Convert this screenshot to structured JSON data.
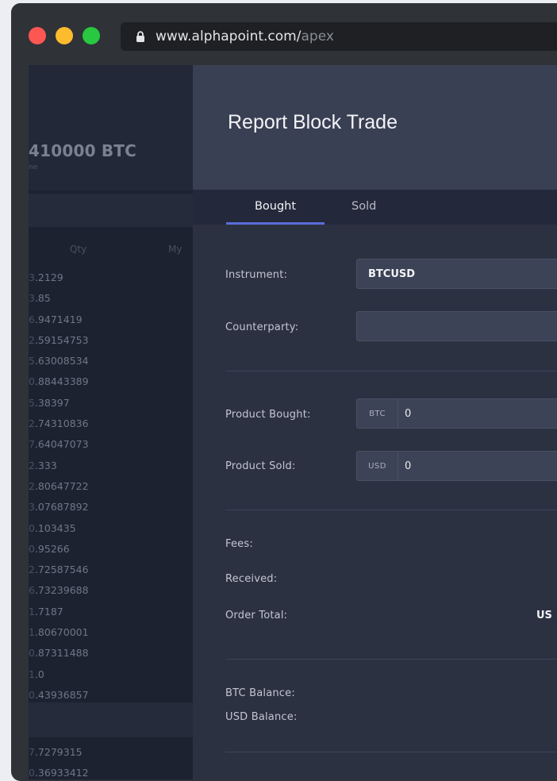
{
  "browser": {
    "url_host": "www.alphapoint.com/",
    "url_path": "apex"
  },
  "order_book": {
    "price": "410000 BTC",
    "price_sub": "ne",
    "columns": {
      "qty": "Qty",
      "my": "My"
    },
    "rows": [
      {
        "lead": "3",
        "rest": ".2129"
      },
      {
        "lead": "3",
        "rest": ".85"
      },
      {
        "lead": "6",
        "rest": ".9471419"
      },
      {
        "lead": "2",
        "rest": ".59154753"
      },
      {
        "lead": "5",
        "rest": ".63008534"
      },
      {
        "lead": "0",
        "rest": ".88443389"
      },
      {
        "lead": "5",
        "rest": ".38397"
      },
      {
        "lead": "2",
        "rest": ".74310836"
      },
      {
        "lead": "7",
        "rest": ".64047073"
      },
      {
        "lead": "2",
        "rest": ".333"
      },
      {
        "lead": "2",
        "rest": ".80647722"
      },
      {
        "lead": "3",
        "rest": ".07687892"
      },
      {
        "lead": "0",
        "rest": ".103435"
      },
      {
        "lead": "0",
        "rest": ".95266"
      },
      {
        "lead": "2",
        "rest": ".72587546"
      },
      {
        "lead": "6",
        "rest": ".73239688"
      },
      {
        "lead": "1",
        "rest": ".7187"
      },
      {
        "lead": "1",
        "rest": ".80670001"
      },
      {
        "lead": "0",
        "rest": ".87311488"
      },
      {
        "lead": "1",
        "rest": ".0"
      },
      {
        "lead": "0",
        "rest": ".43936857"
      }
    ],
    "rows_lower": [
      {
        "lead": "7",
        "rest": ".7279315"
      },
      {
        "lead": "0",
        "rest": ".36933412"
      }
    ]
  },
  "modal": {
    "title": "Report Block Trade",
    "tabs": {
      "bought": "Bought",
      "sold": "Sold"
    },
    "instrument_label": "Instrument:",
    "instrument_value": "BTCUSD",
    "counterparty_label": "Counterparty:",
    "counterparty_value": "",
    "product_bought_label": "Product Bought:",
    "product_bought_unit": "BTC",
    "product_bought_value": "0",
    "product_sold_label": "Product Sold:",
    "product_sold_unit": "USD",
    "product_sold_value": "0",
    "fees_label": "Fees:",
    "received_label": "Received:",
    "order_total_label": "Order Total:",
    "order_total_value": "US",
    "btc_balance_label": "BTC Balance:",
    "usd_balance_label": "USD Balance:"
  },
  "colors": {
    "accent": "#5a6bd9",
    "traffic_red": "#fd5753",
    "traffic_yellow": "#fdbb2e",
    "traffic_green": "#28c840"
  }
}
